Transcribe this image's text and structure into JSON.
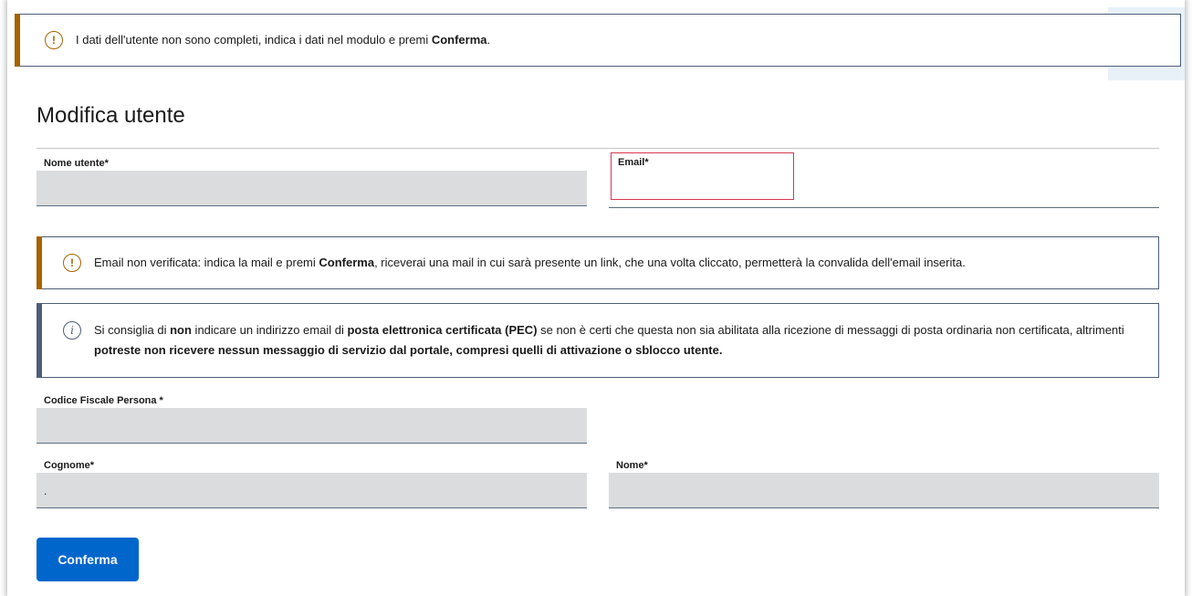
{
  "alerts": {
    "top": {
      "icon": "exclamation-circle-icon",
      "text_before": "I dati dell'utente non sono completi, indica i dati nel modulo e premi ",
      "text_bold": "Conferma",
      "text_after": "."
    },
    "email": {
      "icon": "exclamation-circle-icon",
      "text_before": "Email non verificata: indica la mail e premi ",
      "text_bold": "Conferma",
      "text_after": ", riceverai una mail in cui sarà presente un link, che una volta cliccato, permetterà la convalida dell'email inserita."
    },
    "pec": {
      "icon": "info-circle-icon",
      "p1": "Si consiglia di ",
      "b1": "non",
      "p2": " indicare un indirizzo email di ",
      "b2": "posta elettronica certificata (PEC)",
      "p3": " se non è certi che questa non sia abilitata alla ricezione di messaggi di posta ordinaria non certificata, altrimenti ",
      "b3": "potreste non ricevere nessun messaggio di servizio dal portale, compresi quelli di attivazione o sblocco utente."
    }
  },
  "page": {
    "title": "Modifica utente"
  },
  "form": {
    "nome_utente": {
      "label": "Nome utente*",
      "value": ""
    },
    "email": {
      "label": "Email*",
      "value": ""
    },
    "codice_fiscale": {
      "label": "Codice Fiscale Persona *",
      "value": ""
    },
    "cognome": {
      "label": "Cognome*",
      "value": "."
    },
    "nome": {
      "label": "Nome*",
      "value": ""
    }
  },
  "actions": {
    "confirm_label": "Conferma"
  },
  "colors": {
    "warning": "#a66300",
    "info": "#4d5e76",
    "primary": "#0066cc",
    "error_border": "#d9364f",
    "input_bg": "#dadcdd"
  }
}
